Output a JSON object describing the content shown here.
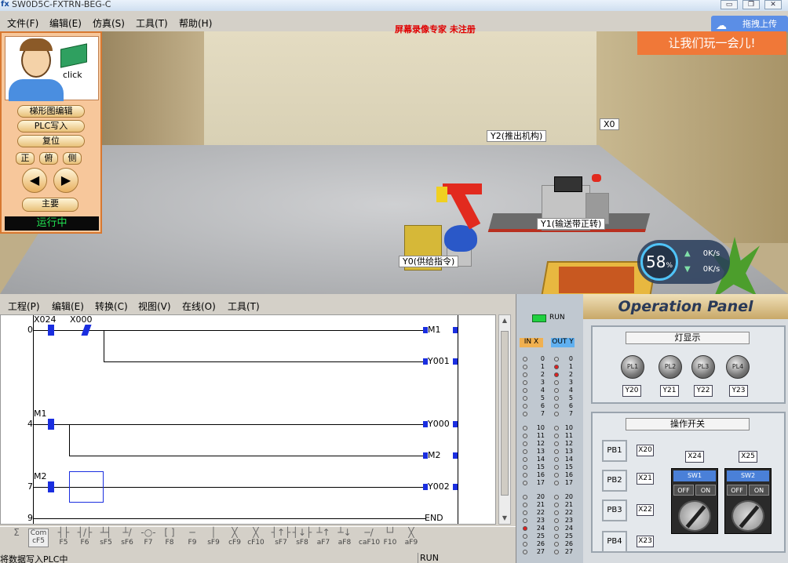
{
  "window": {
    "title": "SW0D5C-FXTRN-BEG-C",
    "watermark": "屏幕录像专家 未注册",
    "minimize": "▭",
    "maximize": "❐",
    "close": "✕"
  },
  "menubar": {
    "items": [
      "文件(F)",
      "编辑(E)",
      "仿真(S)",
      "工具(T)",
      "帮助(H)"
    ]
  },
  "overlay": {
    "upload_label": "拖拽上传",
    "banner": "让我们玩一会儿!",
    "speed_percent": "58",
    "speed_unit": "%",
    "up_rate": "0K/s",
    "down_rate": "0K/s"
  },
  "scene_labels": {
    "y2": "Y2(推出机构)",
    "x0": "X0",
    "y1": "Y1(输送带正转)",
    "y0": "Y0(供给指令)"
  },
  "left_panel": {
    "click_text": "click",
    "buttons": [
      "梯形图编辑",
      "PLC写入",
      "复位"
    ],
    "view_buttons": [
      "正",
      "俯",
      "侧"
    ],
    "left_arrow": "◀",
    "right_arrow": "▶",
    "main_button": "主要",
    "status": "运行中"
  },
  "ladder_menu": {
    "items": [
      "工程(P)",
      "编辑(E)",
      "转换(C)",
      "视图(V)",
      "在线(O)",
      "工具(T)"
    ]
  },
  "ladder": {
    "step_numbers": [
      "0",
      "4",
      "7",
      "9"
    ],
    "contacts": [
      "X024",
      "X000",
      "M1",
      "M2"
    ],
    "coils": [
      "M1",
      "Y001",
      "Y000",
      "M2",
      "Y002"
    ],
    "end_label": "END"
  },
  "toolbar_keys": [
    "F5",
    "F6",
    "sF5",
    "sF6",
    "F7",
    "F8",
    "F9",
    "sF9",
    "cF9",
    "cF10",
    "sF7",
    "sF8",
    "aF7",
    "aF8",
    "caF10",
    "F10",
    "aF9"
  ],
  "toolbar_first": [
    "Com",
    "cF5"
  ],
  "status": {
    "message": "将数据写入PLC中",
    "mode": "RUN"
  },
  "io": {
    "run_label": "RUN",
    "in_header": "IN X",
    "out_header": "OUT Y",
    "rows": [
      "0",
      "1",
      "2",
      "3",
      "4",
      "5",
      "6",
      "7",
      "10",
      "11",
      "12",
      "13",
      "14",
      "15",
      "16",
      "17",
      "20",
      "21",
      "22",
      "23",
      "24",
      "25",
      "26",
      "27"
    ],
    "out_on_rows": [
      "1",
      "2"
    ],
    "in_on_rows": [
      "24"
    ]
  },
  "op_panel": {
    "title": "Operation Panel",
    "lamp_section": "灯显示",
    "lamps": [
      "PL1",
      "PL2",
      "PL3",
      "PL4"
    ],
    "lamp_outputs": [
      "Y20",
      "Y21",
      "Y22",
      "Y23"
    ],
    "switch_section": "操作开关",
    "push_buttons": [
      "PB1",
      "PB2",
      "PB3",
      "PB4"
    ],
    "pb_inputs": [
      "X20",
      "X21",
      "X22",
      "X23"
    ],
    "switches": [
      "SW1",
      "SW2"
    ],
    "switch_inputs": [
      "X24",
      "X25"
    ],
    "off_label": "OFF",
    "on_label": "ON"
  }
}
